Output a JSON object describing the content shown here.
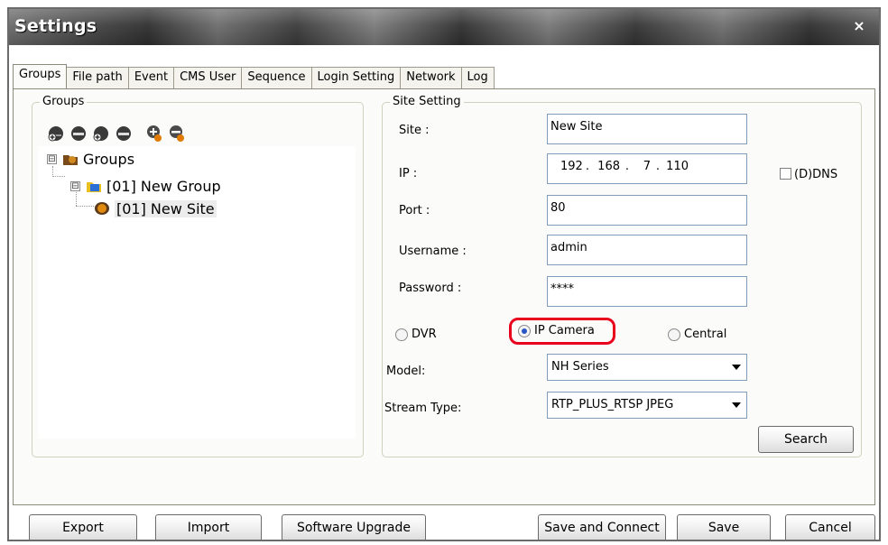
{
  "window": {
    "title": "Settings",
    "close_glyph": "×"
  },
  "tabs": [
    {
      "label": "Groups",
      "active": true
    },
    {
      "label": "File path"
    },
    {
      "label": "Event"
    },
    {
      "label": "CMS User"
    },
    {
      "label": "Sequence"
    },
    {
      "label": "Login Setting"
    },
    {
      "label": "Network"
    },
    {
      "label": "Log"
    }
  ],
  "groups_panel": {
    "legend": "Groups",
    "toolbar_icons": [
      "add-group-icon",
      "remove-group-icon",
      "add-site-icon",
      "remove-site-icon",
      "import-site-icon",
      "export-site-icon"
    ],
    "tree": {
      "root": {
        "label": "Groups",
        "expander": "⊟"
      },
      "group": {
        "label": "[01] New Group",
        "expander": "⊟"
      },
      "site": {
        "label": "[01] New Site"
      }
    }
  },
  "site_setting": {
    "legend": "Site Setting",
    "site_label": "Site :",
    "site_value": "New Site",
    "ip_label": "IP :",
    "ip_octets": [
      "192",
      "168",
      "7",
      "110"
    ],
    "ip_separator": ".",
    "ddns_label": "(D)DNS",
    "ddns_checked": false,
    "port_label": "Port :",
    "port_value": "80",
    "username_label": "Username :",
    "username_value": "admin",
    "password_label": "Password :",
    "password_value": "****",
    "device_types": [
      {
        "label": "DVR",
        "checked": false
      },
      {
        "label": "IP Camera",
        "checked": true
      },
      {
        "label": "Central",
        "checked": false
      }
    ],
    "model_label": "Model:",
    "model_value": "NH Series",
    "stream_label": "Stream Type:",
    "stream_value": "RTP_PLUS_RTSP JPEG",
    "search_label": "Search"
  },
  "footer": {
    "export": "Export",
    "import": "Import",
    "upgrade": "Software Upgrade",
    "save_connect": "Save and Connect",
    "save": "Save",
    "cancel": "Cancel"
  },
  "colors": {
    "highlight": "#e8001c",
    "radio_dot": "#2a56c6"
  }
}
